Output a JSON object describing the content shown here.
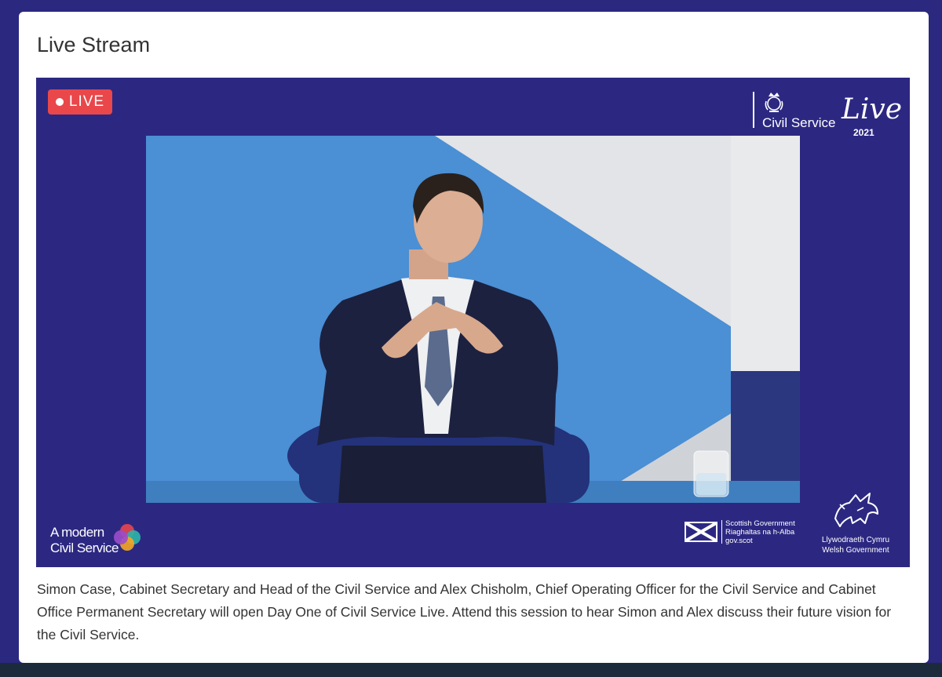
{
  "card": {
    "title": "Live Stream"
  },
  "player": {
    "live_badge": "LIVE",
    "brand_logo": {
      "name": "Civil Service",
      "live_word": "Live",
      "year": "2021"
    },
    "amcs_logo": {
      "line1": "A modern",
      "line2": "Civil Service"
    },
    "scottish_logo": {
      "line1": "Scottish Government",
      "line2": "Riaghaltas na h-Alba",
      "line3": "gov.scot"
    },
    "welsh_logo": {
      "line1": "Llywodraeth Cymru",
      "line2": "Welsh Government"
    }
  },
  "description": "Simon Case, Cabinet Secretary and Head of the Civil Service and Alex Chisholm, Chief Operating Officer for the Civil Service and Cabinet Office Permanent Secretary will open Day One of Civil Service Live. Attend this session to hear Simon and Alex discuss their future vision for the Civil Service.",
  "colors": {
    "page_background": "#2b2880",
    "card_background": "#ffffff",
    "player_background": "#2c2882",
    "live_badge": "#e9474a",
    "footer": "#1c2b3c"
  },
  "icons": {
    "live_indicator": "live-dot-icon",
    "crest": "royal-crest-icon",
    "saltire": "saltire-flag-icon",
    "dragon": "welsh-dragon-icon",
    "circles": "modern-circles-icon"
  }
}
